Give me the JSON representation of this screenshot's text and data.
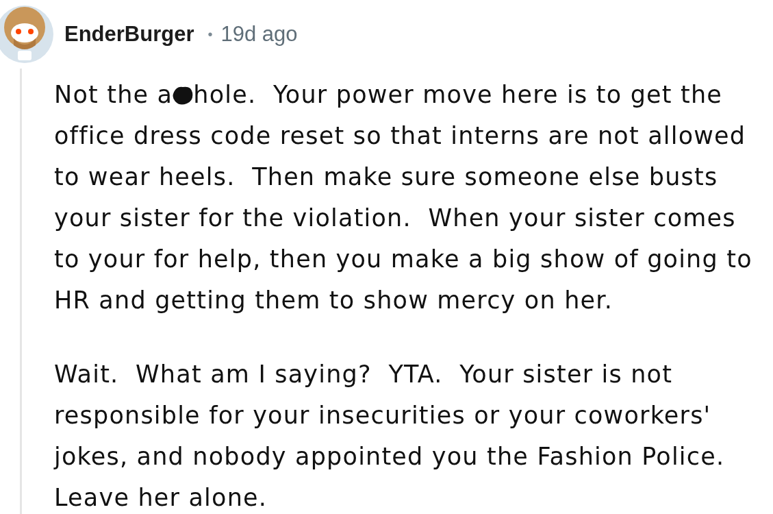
{
  "comment": {
    "author": "EnderBurger",
    "separator": "•",
    "age": "19d ago",
    "paragraphs": [
      {
        "kind": "censored",
        "before": "Not the a",
        "after": "hole.  Your power move here is to get the",
        "rest": "office dress code reset so that interns are not allowed to wear heels.  Then make sure someone else busts your sister for the violation.  When your sister comes to your for help, then you make a big show of going to HR and getting them to show mercy on her."
      },
      {
        "kind": "plain",
        "text": "Wait.  What am I saying?  YTA.  Your sister is not responsible for your insecurities or your coworkers' jokes, and nobody appointed you the Fashion Police.  Leave her alone."
      }
    ]
  }
}
